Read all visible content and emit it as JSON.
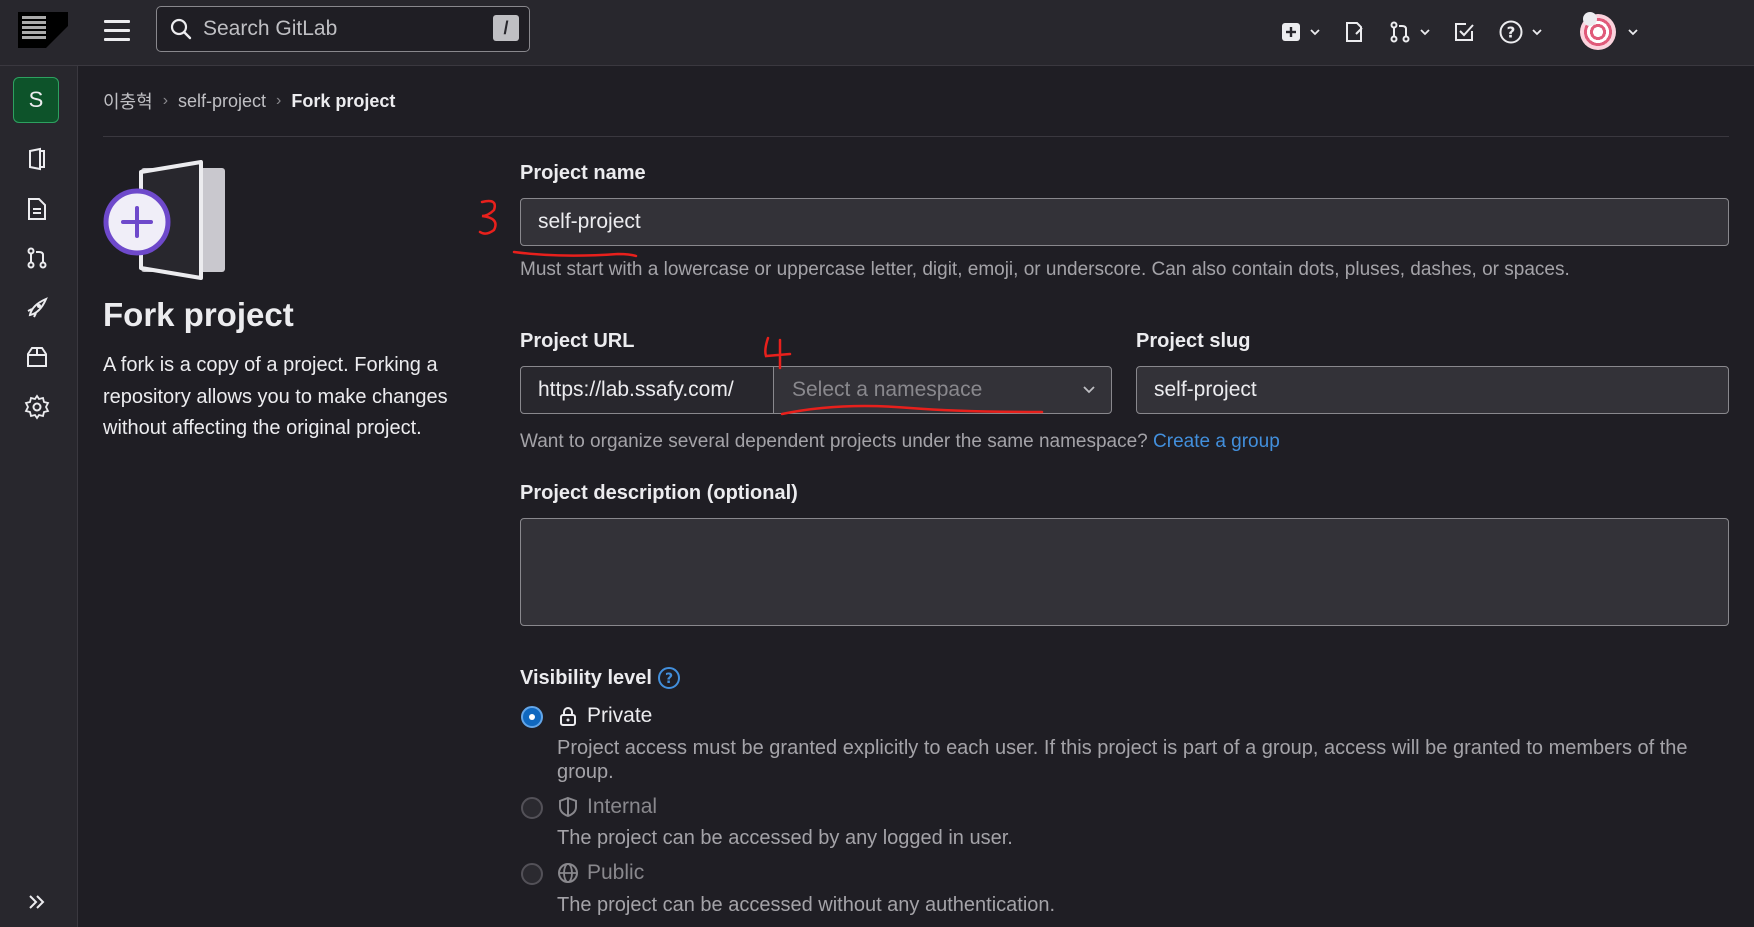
{
  "topbar": {
    "search_placeholder": "Search GitLab",
    "search_shortcut": "/",
    "icons": [
      "plus-square-icon",
      "issues-icon",
      "merge-request-icon",
      "todo-icon",
      "help-icon",
      "user-avatar"
    ]
  },
  "sidebar": {
    "project_initial": "S",
    "items": [
      "project-overview-icon",
      "file-icon",
      "merge-request-icon",
      "deploy-rocket-icon",
      "package-icon",
      "settings-gear-icon"
    ],
    "expand_icon": "chevron-double-right-icon"
  },
  "breadcrumb": {
    "items": [
      "이충혁",
      "self-project"
    ],
    "current": "Fork project"
  },
  "left_panel": {
    "title": "Fork project",
    "description": "A fork is a copy of a project. Forking a repository allows you to make changes without affecting the original project."
  },
  "form": {
    "project_name_label": "Project name",
    "project_name_value": "self-project",
    "project_name_help": "Must start with a lowercase or uppercase letter, digit, emoji, or underscore. Can also contain dots, pluses, dashes, or spaces.",
    "project_url_label": "Project URL",
    "project_url_prefix": "https://lab.ssafy.com/",
    "namespace_placeholder": "Select a namespace",
    "project_slug_label": "Project slug",
    "project_slug_value": "self-project",
    "namespace_help": "Want to organize several dependent projects under the same namespace?",
    "create_group_link": "Create a group",
    "description_label": "Project description (optional)",
    "visibility_label": "Visibility level",
    "visibility_options": [
      {
        "label": "Private",
        "selected": true,
        "icon": "lock-icon",
        "description": "Project access must be granted explicitly to each user. If this project is part of a group, access will be granted to members of the group."
      },
      {
        "label": "Internal",
        "selected": false,
        "icon": "shield-icon",
        "description": "The project can be accessed by any logged in user."
      },
      {
        "label": "Public",
        "selected": false,
        "icon": "globe-icon",
        "description": "The project can be accessed without any authentication."
      }
    ]
  },
  "annotations": {
    "mark_3": "3",
    "mark_4": "4",
    "color": "#e8201c"
  }
}
